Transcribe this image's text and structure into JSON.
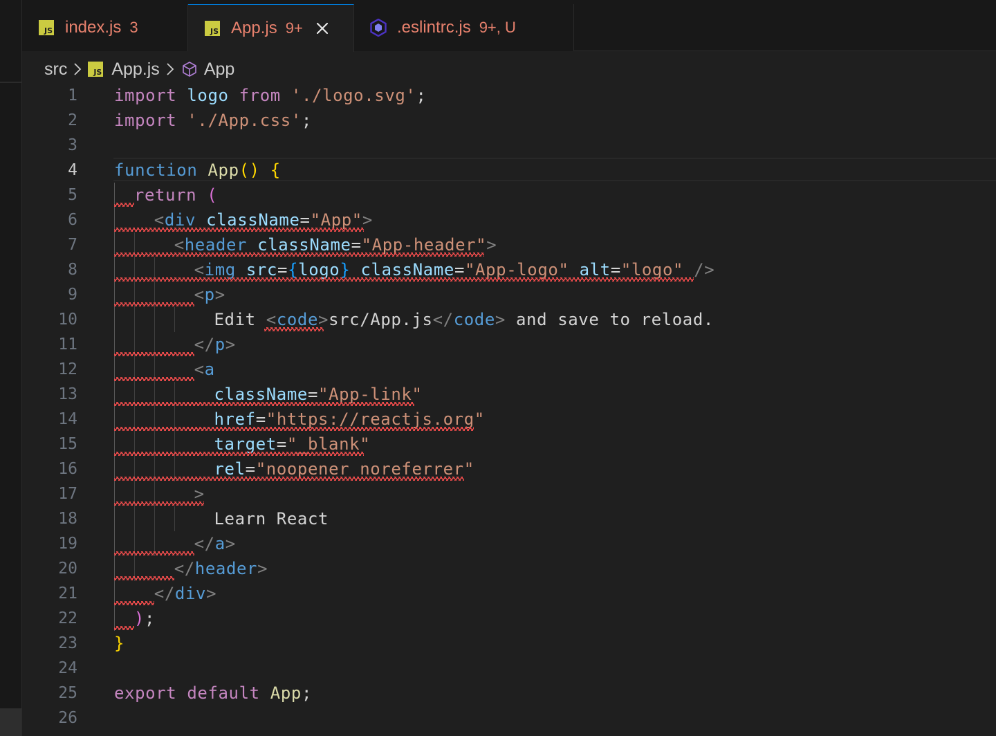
{
  "tabs": [
    {
      "label": "index.js",
      "badge": "3",
      "icon": "js-file-icon",
      "active": false
    },
    {
      "label": "App.js",
      "badge": "9+",
      "icon": "js-file-icon",
      "active": true
    },
    {
      "label": ".eslintrc.js",
      "badge": "9+, U",
      "icon": "eslint-file-icon",
      "active": false
    }
  ],
  "breadcrumb": {
    "folder": "src",
    "file": "App.js",
    "symbol": "App",
    "file_icon_text": "JS"
  },
  "js_icon_text": "JS",
  "editor": {
    "current_line": 4,
    "line_numbers": [
      "1",
      "2",
      "3",
      "4",
      "5",
      "6",
      "7",
      "8",
      "9",
      "10",
      "11",
      "12",
      "13",
      "14",
      "15",
      "16",
      "17",
      "18",
      "19",
      "20",
      "21",
      "22",
      "23",
      "24",
      "25",
      "26"
    ],
    "code": {
      "l1": [
        "import",
        " ",
        "logo",
        " ",
        "from",
        " ",
        "'./logo.svg'",
        ";"
      ],
      "l2": [
        "import",
        " ",
        "'./App.css'",
        ";"
      ],
      "l4": [
        "function",
        " ",
        "App",
        "()",
        " ",
        "{"
      ],
      "l5": [
        "return",
        " ",
        "("
      ],
      "l6": [
        "<",
        "div",
        " ",
        "className",
        "=",
        "\"App\"",
        ">"
      ],
      "l7": [
        "<",
        "header",
        " ",
        "className",
        "=",
        "\"App-header\"",
        ">"
      ],
      "l8": [
        "<",
        "img",
        " ",
        "src",
        "=",
        "{",
        "logo",
        "}",
        " ",
        "className",
        "=",
        "\"App-logo\"",
        " ",
        "alt",
        "=",
        "\"logo\"",
        " ",
        "/>"
      ],
      "l9": [
        "<",
        "p",
        ">"
      ],
      "l10": [
        "Edit ",
        "<",
        "code",
        ">",
        "src/App.js",
        "</",
        "code",
        ">",
        " and save to reload."
      ],
      "l11": [
        "</",
        "p",
        ">"
      ],
      "l12": [
        "<",
        "a"
      ],
      "l13": [
        "className",
        "=",
        "\"App-link\""
      ],
      "l14": [
        "href",
        "=",
        "\"https://reactjs.org\""
      ],
      "l15": [
        "target",
        "=",
        "\"_blank\""
      ],
      "l16": [
        "rel",
        "=",
        "\"noopener noreferrer\""
      ],
      "l17": [
        ">"
      ],
      "l18": [
        "Learn React"
      ],
      "l19": [
        "</",
        "a",
        ">"
      ],
      "l20": [
        "</",
        "header",
        ">"
      ],
      "l21": [
        "</",
        "div",
        ">"
      ],
      "l22": [
        ")",
        ";"
      ],
      "l23": [
        "}"
      ],
      "l25": [
        "export",
        " ",
        "default",
        " ",
        "App",
        ";"
      ]
    }
  },
  "colors": {
    "error": "#f14c4c",
    "tab_modified": "#e7816d",
    "active_tab_border": "#0078d4",
    "js_icon": "#cbcb41"
  }
}
